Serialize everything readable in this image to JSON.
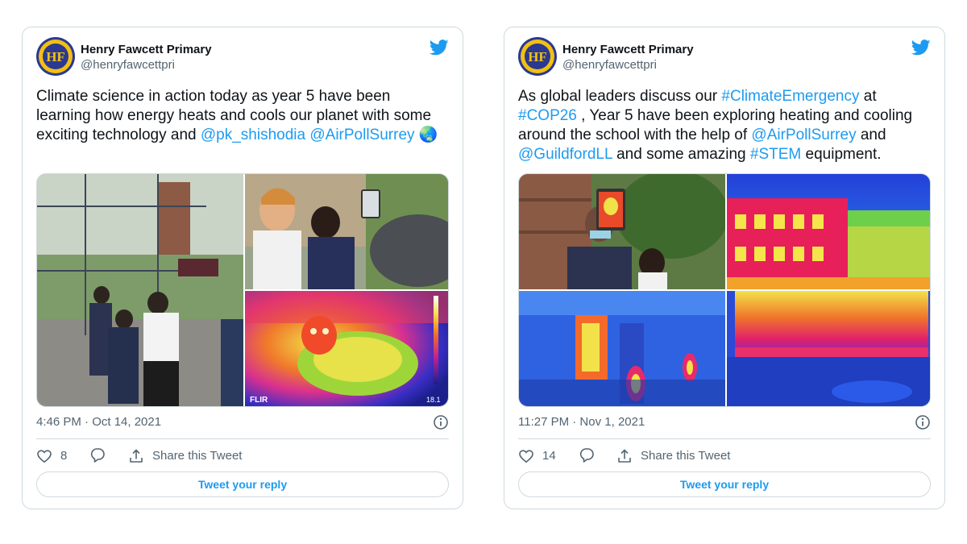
{
  "tweets": [
    {
      "author_name": "Henry Fawcett Primary",
      "author_handle": "@henryfawcettpri",
      "avatar_initials": "HF",
      "text_segments": [
        {
          "text": "Climate science in action today as year 5 have been learning how energy heats and cools our planet with some exciting technology and ",
          "link": false
        },
        {
          "text": "@pk_shishodia",
          "link": true
        },
        {
          "text": " ",
          "link": false
        },
        {
          "text": "@AirPollSurrey",
          "link": true
        },
        {
          "text": " 🌏",
          "link": false
        }
      ],
      "timestamp": "4:46 PM · Oct 14, 2021",
      "likes": "8",
      "share_label": "Share this Tweet",
      "reply_label": "Tweet your reply",
      "thermal_brand": "FLIR",
      "thermal_temp": "18.1"
    },
    {
      "author_name": "Henry Fawcett Primary",
      "author_handle": "@henryfawcettpri",
      "avatar_initials": "HF",
      "text_segments": [
        {
          "text": "As global leaders discuss our ",
          "link": false
        },
        {
          "text": "#ClimateEmergency",
          "link": true
        },
        {
          "text": " at ",
          "link": false
        },
        {
          "text": "#COP26",
          "link": true
        },
        {
          "text": " , Year 5 have been exploring heating and cooling around the school with the help of ",
          "link": false
        },
        {
          "text": "@AirPollSurrey",
          "link": true
        },
        {
          "text": " and ",
          "link": false
        },
        {
          "text": "@GuildfordLL",
          "link": true
        },
        {
          "text": " and some amazing ",
          "link": false
        },
        {
          "text": "#STEM",
          "link": true
        },
        {
          "text": " equipment.",
          "link": false
        }
      ],
      "timestamp": "11:27 PM · Nov 1, 2021",
      "likes": "14",
      "share_label": "Share this Tweet",
      "reply_label": "Tweet your reply"
    }
  ],
  "colors": {
    "link": "#1d9bf0",
    "secondary_text": "#536471",
    "border": "#cfd9de",
    "avatar_bg": "#2b3990",
    "avatar_gold": "#f2c014"
  },
  "icons": [
    "twitter-bird-icon",
    "info-icon",
    "heart-icon",
    "reply-bubble-icon",
    "share-icon"
  ]
}
